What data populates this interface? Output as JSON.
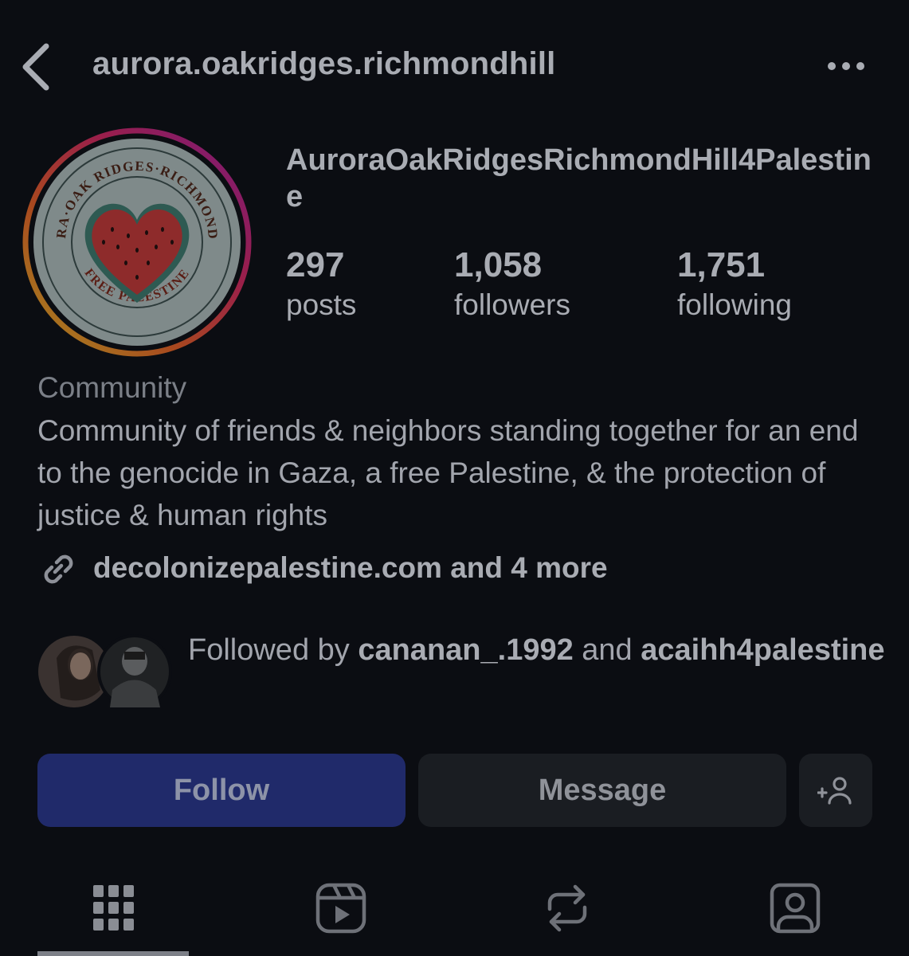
{
  "header": {
    "username": "aurora.oakridges.richmondhill",
    "back_icon": "chevron-left-icon",
    "more_icon": "more-horizontal-icon"
  },
  "profile": {
    "display_name": "AuroraOakRidgesRichmondHill4Palestine",
    "avatar_text_top": "AURORA·OAK RIDGES·RICHMOND HILL",
    "avatar_text_bottom": "FREE PALESTINE",
    "stats": {
      "posts": {
        "value": "297",
        "label": "posts"
      },
      "followers": {
        "value": "1,058",
        "label": "followers"
      },
      "following": {
        "value": "1,751",
        "label": "following"
      }
    },
    "category": "Community",
    "bio": "Community of friends & neighbors standing together for an end to the genocide in Gaza, a free Palestine, & the protection of justice & human rights",
    "link": {
      "icon": "link-icon",
      "text": "decolonizepalestine.com and 4 more"
    }
  },
  "followed_by": {
    "prefix": "Followed by ",
    "user1": "cananan_.1992",
    "connector": " and ",
    "user2": "acaihh4palestine"
  },
  "actions": {
    "follow_label": "Follow",
    "message_label": "Message",
    "add_user_icon": "add-user-icon"
  },
  "tabs": [
    {
      "name": "posts-grid",
      "icon": "grid-icon"
    },
    {
      "name": "reels",
      "icon": "reels-icon"
    },
    {
      "name": "reposts",
      "icon": "repost-icon"
    },
    {
      "name": "tagged",
      "icon": "tagged-user-icon"
    }
  ],
  "colors": {
    "background": "#0b0d12",
    "follow_button": "#202a6a",
    "secondary_button": "#1a1d22",
    "text": "#a9acb3"
  }
}
